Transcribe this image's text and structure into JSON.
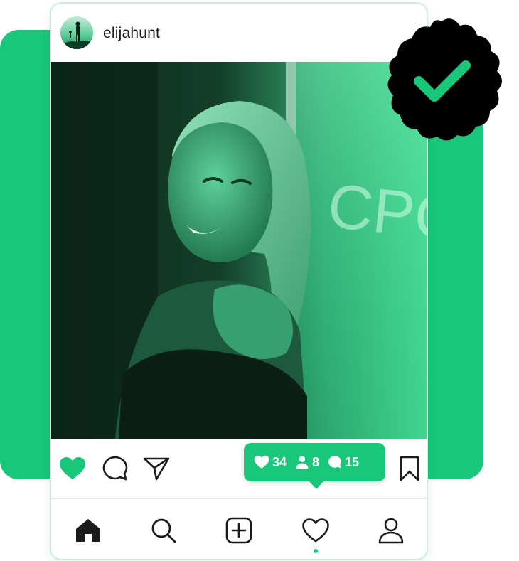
{
  "post": {
    "username": "elijahunt",
    "photo_sign_text": "CPC"
  },
  "stats": {
    "likes": "34",
    "followers": "8",
    "comments": "15"
  },
  "actions": {
    "like_icon": "heart-filled-icon",
    "comment_icon": "comment-icon",
    "share_icon": "send-icon",
    "save_icon": "bookmark-icon"
  },
  "nav": {
    "items": [
      "home-icon",
      "search-icon",
      "add-post-icon",
      "heart-icon",
      "profile-icon"
    ],
    "active_indicator": "heart-icon"
  },
  "colors": {
    "accent": "#18c779",
    "badge": "#000000",
    "text": "#1b1b1b"
  }
}
